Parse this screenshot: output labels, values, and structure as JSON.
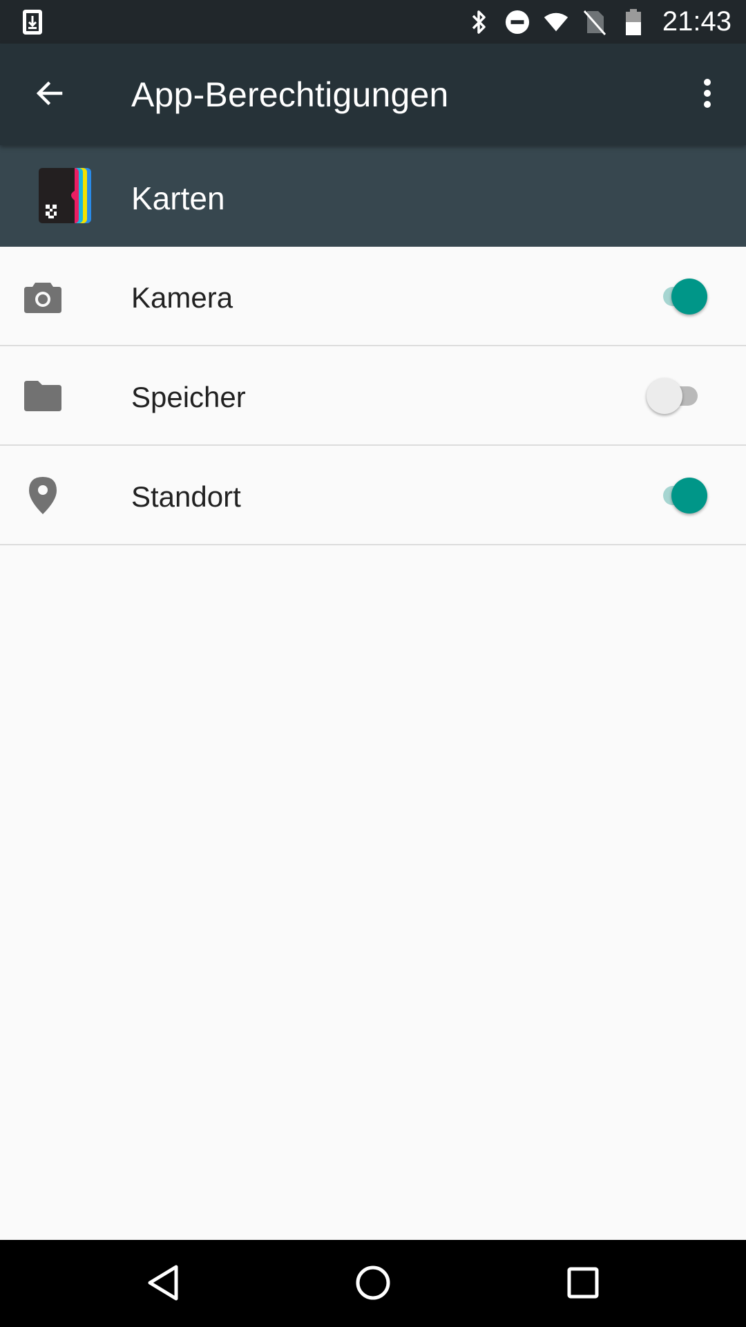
{
  "status_bar": {
    "time": "21:43",
    "icons": [
      "download-notification-icon",
      "bluetooth-icon",
      "do-not-disturb-icon",
      "wifi-icon",
      "no-sim-icon",
      "battery-icon"
    ]
  },
  "toolbar": {
    "title": "App-Berechtigungen",
    "back_icon": "arrow-back-icon",
    "overflow_icon": "more-vert-icon"
  },
  "app": {
    "name": "Karten"
  },
  "permissions": [
    {
      "label": "Kamera",
      "icon": "camera-icon",
      "enabled": true
    },
    {
      "label": "Speicher",
      "icon": "folder-icon",
      "enabled": false
    },
    {
      "label": "Standort",
      "icon": "location-pin-icon",
      "enabled": true
    }
  ],
  "nav_bar": {
    "buttons": [
      "nav-back-icon",
      "nav-home-icon",
      "nav-recents-icon"
    ]
  },
  "colors": {
    "status_bar": "#21272b",
    "toolbar": "#263238",
    "app_header": "#37474f",
    "accent": "#009688",
    "background": "#fafafa"
  }
}
